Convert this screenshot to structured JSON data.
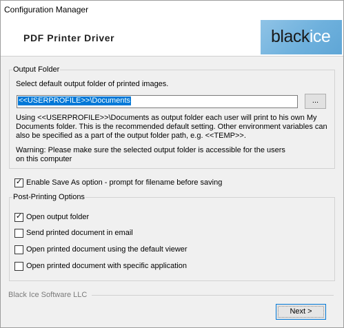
{
  "window": {
    "title": "Configuration Manager"
  },
  "header": {
    "product": "PDF Printer Driver",
    "logo_black": "black",
    "logo_ice": "ice",
    "logo_colors": {
      "bg": "#6fb1dd",
      "black": "#1a1a1a",
      "ice": "#ffffff"
    }
  },
  "output_folder": {
    "legend": "Output Folder",
    "instruction": "Select default output folder of printed images.",
    "path_value": "<<USERPROFILE>>\\Documents",
    "browse_label": "...",
    "info_line1": "Using <<USERPROFILE>>\\Documents as output folder each user will print to his own My",
    "info_line2": "Documents folder. This is the recommended default setting. Other environment variables can",
    "info_line3": "also be specified as a part of the output folder path, e.g. <<TEMP>>.",
    "warning_line1": "Warning:  Please make sure the selected output folder is accessible for the users",
    "warning_line2": "on this computer"
  },
  "save_as": {
    "label": "Enable Save As option - prompt for filename before saving",
    "checked": true
  },
  "post_printing": {
    "legend": "Post-Printing Options",
    "options": [
      {
        "label": "Open output folder",
        "checked": true
      },
      {
        "label": "Send printed document in email",
        "checked": false
      },
      {
        "label": "Open printed document using the default viewer",
        "checked": false
      },
      {
        "label": "Open printed document with specific application",
        "checked": false
      }
    ]
  },
  "footer": {
    "company": "Black Ice Software LLC",
    "next_label": "Next >"
  },
  "colors": {
    "accent": "#0078d7",
    "selection_bg": "#0078d7"
  }
}
